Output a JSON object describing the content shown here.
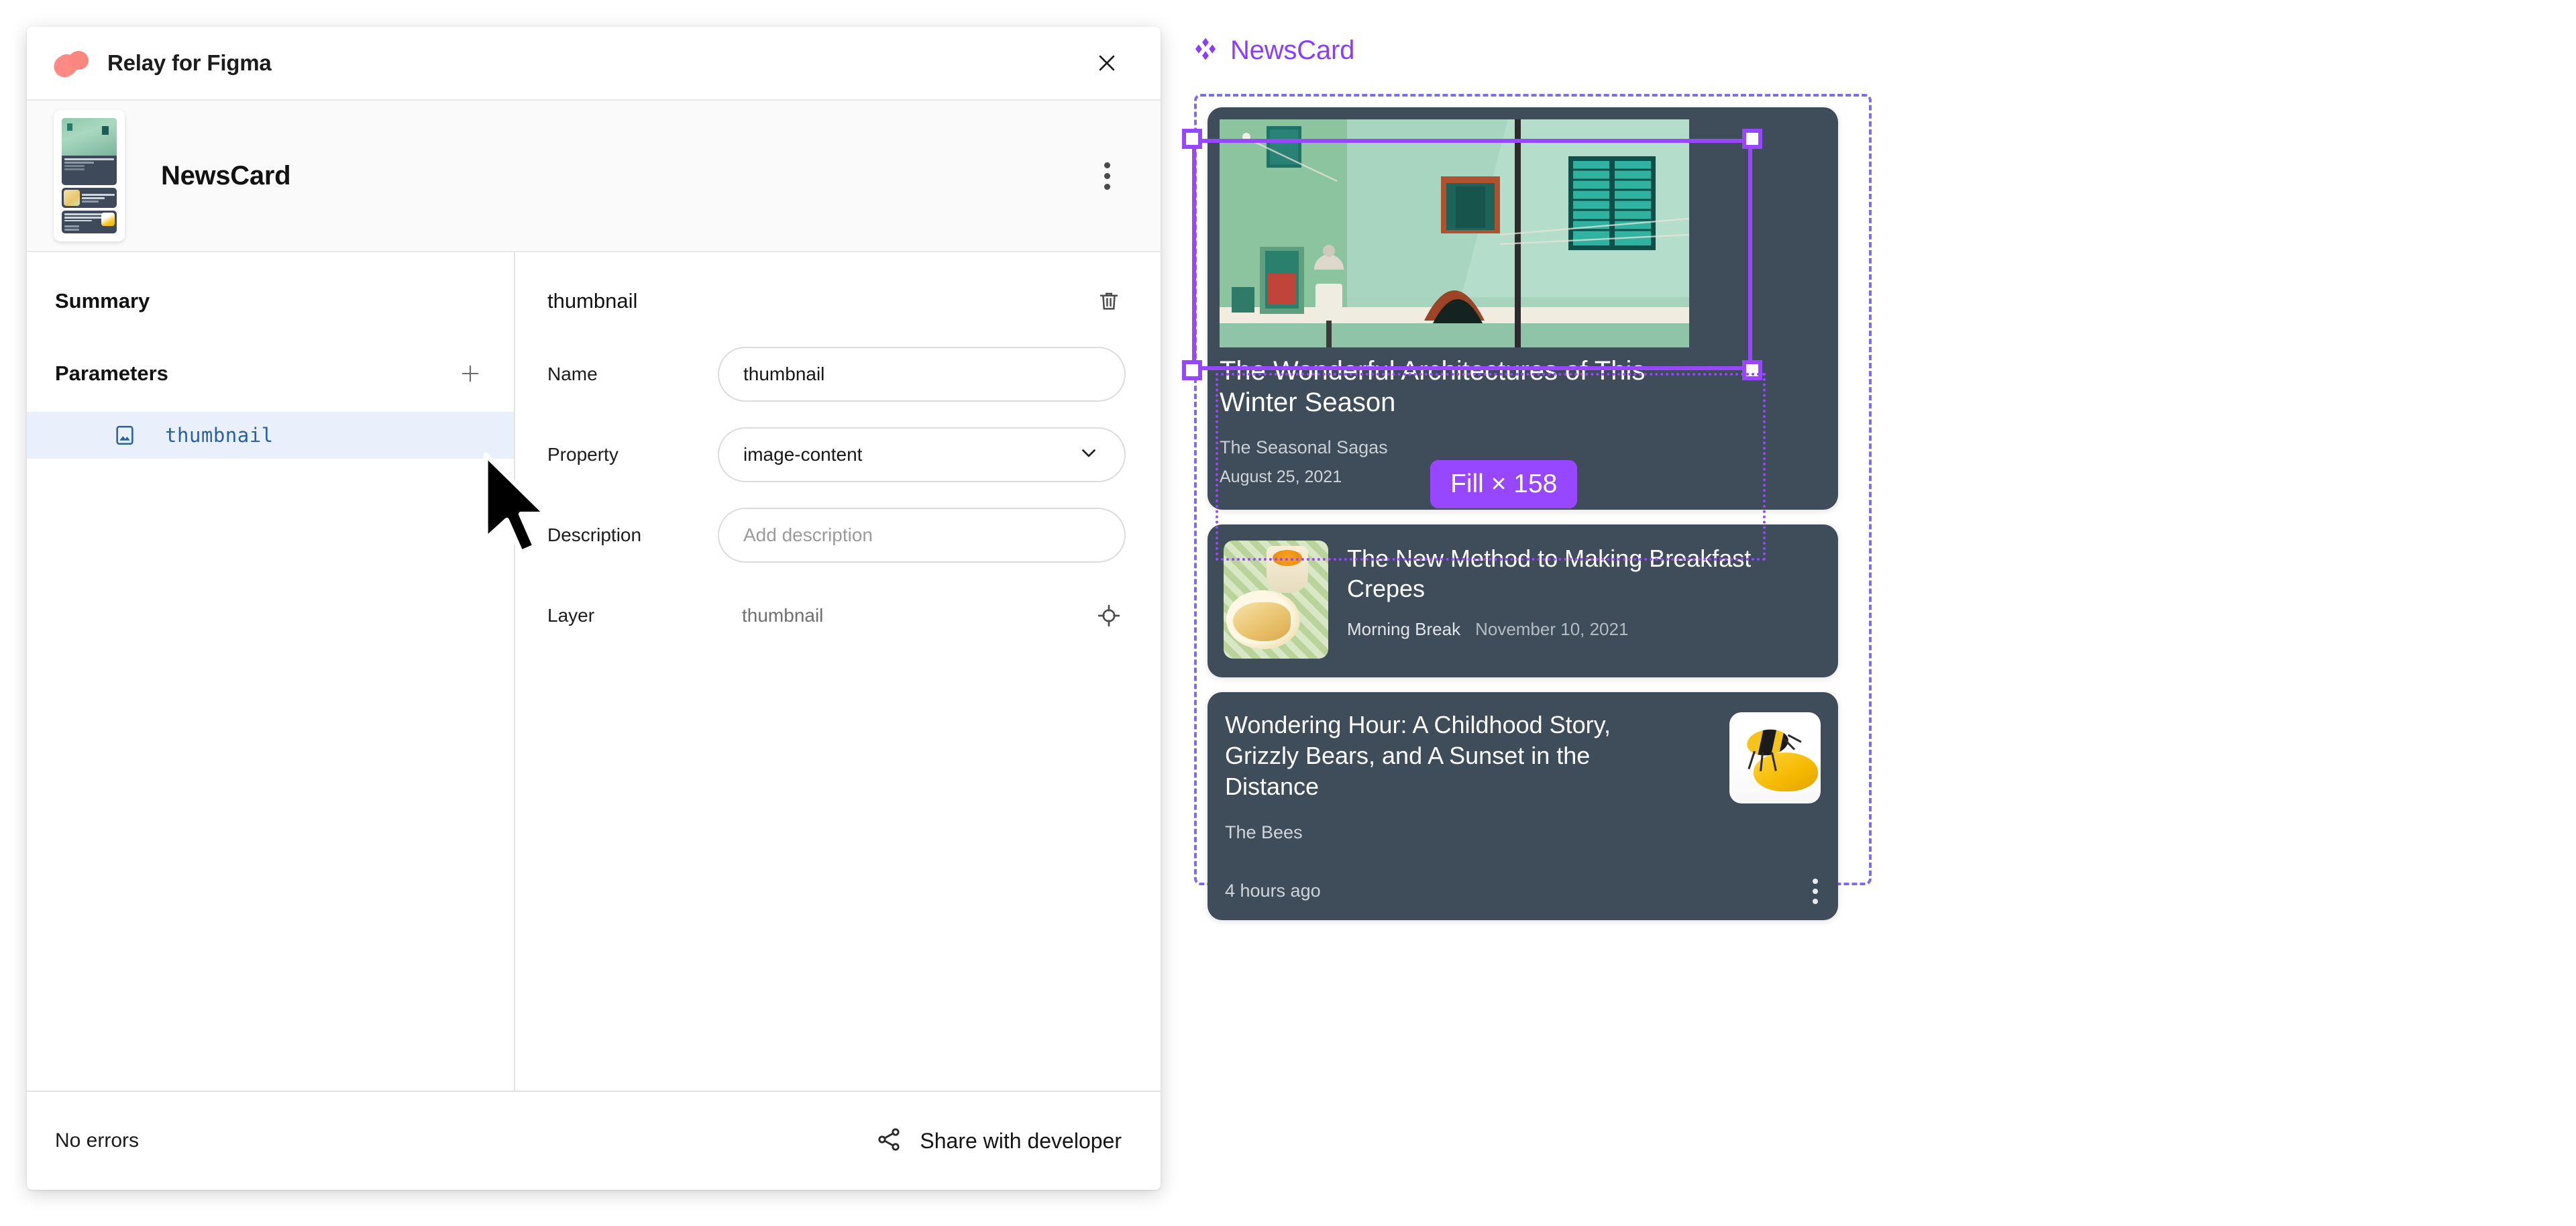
{
  "plugin": {
    "title": "Relay for Figma",
    "logo_icon": "relay-logo-icon",
    "close_icon": "close-icon",
    "component": {
      "name": "NewsCard",
      "more_icon": "more-vertical-icon",
      "thumbnail_icon": "component-preview-thumbnail"
    },
    "left_column": {
      "summary_label": "Summary",
      "parameters_label": "Parameters",
      "add_icon": "plus-icon",
      "parameters": [
        {
          "label": "thumbnail",
          "icon": "image-icon",
          "selected": true
        }
      ]
    },
    "detail": {
      "title": "thumbnail",
      "delete_icon": "trash-icon",
      "fields": [
        {
          "label": "Name",
          "value": "thumbnail",
          "placeholder": "",
          "type": "text"
        },
        {
          "label": "Property",
          "value": "image-content",
          "placeholder": "",
          "type": "select",
          "chevron_icon": "chevron-down-icon"
        },
        {
          "label": "Description",
          "value": "",
          "placeholder": "Add description",
          "type": "text"
        }
      ],
      "layer_label": "Layer",
      "layer_value": "thumbnail",
      "layer_target_icon": "crosshair-target-icon"
    },
    "footer": {
      "status": "No errors",
      "share_label": "Share with developer",
      "share_icon": "share-icon"
    }
  },
  "cursor": {
    "icon": "arrow-cursor-icon"
  },
  "canvas": {
    "frame_name": "NewsCard",
    "frame_icon": "component-diamond-icon",
    "selection": {
      "badge_label": "Fill × 158",
      "accent_color": "#9747ff",
      "frame_outline_color": "#7c6cf0"
    },
    "cards": [
      {
        "title": "The Wonderful Architectures of This Winter Season",
        "source": "The Seasonal Sagas",
        "date": "August 25, 2021",
        "image_icon": "green-building-photo"
      },
      {
        "title": "The New Method to Making Breakfast Crepes",
        "source": "Morning Break",
        "date": "November 10, 2021",
        "image_icon": "breakfast-crepes-photo"
      },
      {
        "title": "Wondering Hour: A Childhood Story, Grizzly Bears, and A Sunset in the Distance",
        "source": "The Bees",
        "date": "4 hours ago",
        "image_icon": "bee-photo",
        "more_icon": "more-vertical-icon"
      }
    ]
  }
}
